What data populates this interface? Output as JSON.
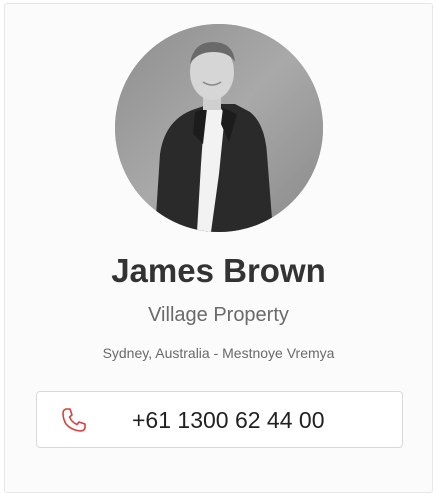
{
  "profile": {
    "name": "James Brown",
    "company": "Village Property",
    "location": "Sydney, Australia - Mestnoye Vremya",
    "photo": "headshot-photo"
  },
  "contact": {
    "phone_icon": "phone-icon",
    "phone_number": "+61 1300 62 44 00",
    "accent_color": "#d9403a"
  }
}
